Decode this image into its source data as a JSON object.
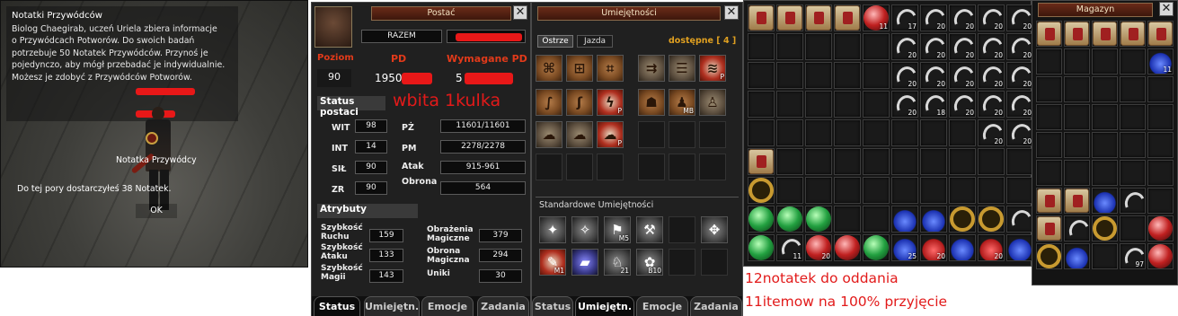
{
  "scene": {
    "quest_title": "Notatki Przywódców",
    "quest_lines": [
      "Biolog Chaegirab, uczeń Uriela zbiera informacje",
      "o Przywódcach Potworów. Do swoich badań",
      "potrzebuje 50 Notatek Przywódców. Przynoś je",
      "pojedynczo, aby mógł przebadać je indywidualnie.",
      "Możesz je zdobyć z Przywódców Potworów."
    ],
    "npc_label": "Notatka Przywódcy",
    "delivered_text": "Do tej pory dostarczyłeś 38 Notatek.",
    "ok_label": "OK"
  },
  "character": {
    "title": "Postać",
    "close": "✕",
    "guild": "RAZEM",
    "level_label": "Poziom",
    "level_value": "90",
    "pd_label": "PD",
    "pd_value": "1950",
    "req_pd_label": "Wymagane PD",
    "req_pd_value": "5",
    "status_label": "Status postaci",
    "annotation": "wbita 1kulka",
    "stats": [
      {
        "name": "WIT",
        "value": "98"
      },
      {
        "name": "INT",
        "value": "14"
      },
      {
        "name": "SIŁ",
        "value": "90"
      },
      {
        "name": "ZR",
        "value": "90"
      }
    ],
    "derived": [
      {
        "name": "PŻ",
        "value": "11601/11601"
      },
      {
        "name": "PM",
        "value": "2278/2278"
      },
      {
        "name": "Atak",
        "value": "915-961"
      },
      {
        "name": "Obrona",
        "value": "564"
      }
    ],
    "attr_label": "Atrybuty",
    "attributes_left": [
      {
        "name": "Szybkość Ruchu",
        "value": "159"
      },
      {
        "name": "Szybkość Ataku",
        "value": "133"
      },
      {
        "name": "Szybkość Magii",
        "value": "143"
      }
    ],
    "attributes_right": [
      {
        "name": "Obrażenia Magiczne",
        "value": "379"
      },
      {
        "name": "Obrona Magiczna",
        "value": "294"
      },
      {
        "name": "Uniki",
        "value": "30"
      }
    ],
    "tabs": [
      "Status",
      "Umiejętn.",
      "Emocje",
      "Zadania"
    ]
  },
  "skills": {
    "title": "Umiejętności",
    "close": "✕",
    "subtabs": [
      "Ostrze",
      "Jazda"
    ],
    "available_label": "dostępne",
    "available_value": "4",
    "standard_label": "Standardowe Umiejętności",
    "skill_badges": [
      "P",
      "P",
      "MB",
      "P"
    ],
    "std_badges": [
      "M5",
      "M1",
      "21",
      "B10"
    ],
    "tabs": [
      "Status",
      "Umiejętn.",
      "Emocje",
      "Zadania"
    ]
  },
  "inventory": {
    "counts": [
      "11",
      "17",
      "20",
      "20",
      "20",
      "20",
      "20",
      "20",
      "20",
      "20",
      "20",
      "20",
      "20",
      "20",
      "20",
      "20",
      "20",
      "18",
      "20",
      "20",
      "20",
      "20",
      "20",
      "30"
    ],
    "bottom_counts": [
      "11",
      "20",
      "25",
      "20",
      "20"
    ]
  },
  "storage": {
    "title": "Magazyn",
    "close": "✕",
    "count_top": "11",
    "count_bottom": "97"
  },
  "annotations": {
    "line1": "12notatek do oddania",
    "line2": "11itemow na 100% przyjęcie"
  },
  "colors": {
    "annotation_red": "#e21a1a",
    "title_brown": "#6a2b18"
  }
}
